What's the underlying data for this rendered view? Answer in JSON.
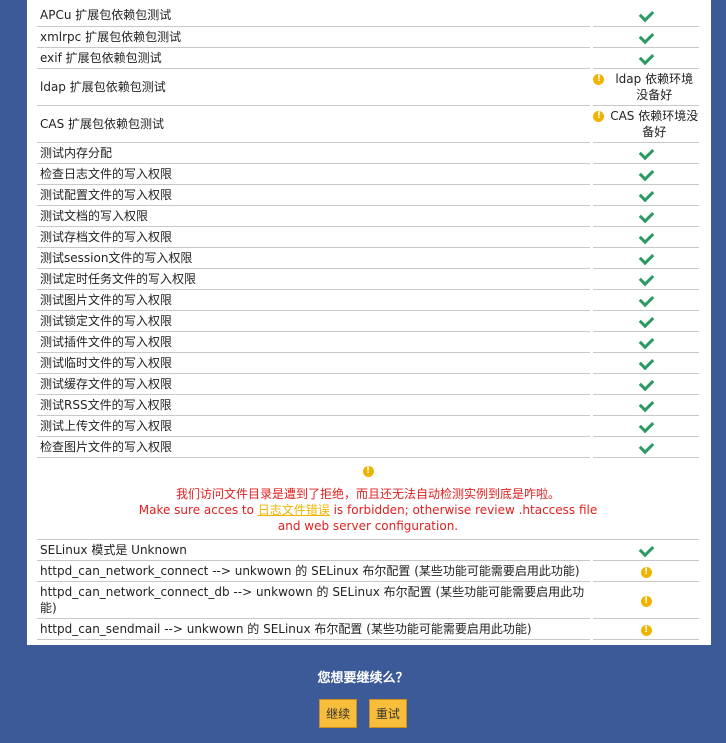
{
  "rows": [
    {
      "label": "APCu 扩展包依赖包测试",
      "status": "ok",
      "h": 21
    },
    {
      "label": "xmlrpc 扩展包依赖包测试",
      "status": "ok",
      "h": 21
    },
    {
      "label": "exif 扩展包依赖包测试",
      "status": "ok",
      "h": 21
    },
    {
      "label": "ldap 扩展包依赖包测试",
      "status": "warn",
      "msg": "ldap 依赖环境没备好",
      "h": 37
    },
    {
      "label": "CAS 扩展包依赖包测试",
      "status": "warn",
      "msg": "CAS 依赖环境没备好",
      "h": 37
    },
    {
      "label": "测试内存分配",
      "status": "ok",
      "h": 21
    },
    {
      "label": "检查日志文件的写入权限",
      "status": "ok",
      "h": 21
    },
    {
      "label": "测试配置文件的写入权限",
      "status": "ok",
      "h": 21
    },
    {
      "label": "测试文档的写入权限",
      "status": "ok",
      "h": 21
    },
    {
      "label": "测试存档文件的写入权限",
      "status": "ok",
      "h": 21
    },
    {
      "label": "测试session文件的写入权限",
      "status": "ok",
      "h": 21
    },
    {
      "label": "测试定时任务文件的写入权限",
      "status": "ok",
      "h": 21
    },
    {
      "label": "测试图片文件的写入权限",
      "status": "ok",
      "h": 21
    },
    {
      "label": "测试锁定文件的写入权限",
      "status": "ok",
      "h": 21
    },
    {
      "label": "测试插件文件的写入权限",
      "status": "ok",
      "h": 21
    },
    {
      "label": "测试临时文件的写入权限",
      "status": "ok",
      "h": 21
    },
    {
      "label": "测试缓存文件的写入权限",
      "status": "ok",
      "h": 21
    },
    {
      "label": "测试RSS文件的写入权限",
      "status": "ok",
      "h": 21
    },
    {
      "label": "测试上传文件的写入权限",
      "status": "ok",
      "h": 21
    },
    {
      "label": "检查图片文件的写入权限",
      "status": "ok",
      "h": 21
    }
  ],
  "access_warning": {
    "line1": "我们访问文件目录是遭到了拒绝，而且还无法自动检测实例到底是咋啦。",
    "line2_pre": "Make sure acces to ",
    "line2_link": "日志文件错误",
    "line2_post": " is forbidden; otherwise review .htaccess file and web server configuration."
  },
  "selinux_rows": [
    {
      "label": "SELinux 模式是 Unknown",
      "status": "ok",
      "h": 21
    },
    {
      "label": "httpd_can_network_connect --> unkwown 的 SELinux 布尔配置 (某些功能可能需要启用此功能)",
      "status": "warn",
      "h": 21
    },
    {
      "label": "httpd_can_network_connect_db --> unkwown 的 SELinux 布尔配置 (某些功能可能需要启用此功能)",
      "status": "warn",
      "h": 37
    },
    {
      "label": "httpd_can_sendmail --> unkwown 的 SELinux 布尔配置 (某些功能可能需要启用此功能)",
      "status": "warn",
      "h": 21
    }
  ],
  "continue_text": "您想要继续么？",
  "buttons": {
    "continue": "继续",
    "retry": "重试"
  },
  "icons": {
    "ok": "check-icon",
    "warn": "warning-icon"
  },
  "colors": {
    "ok": "#2a9a62",
    "warn": "#f0b400",
    "error_text": "#e02020",
    "background": "#3b5a97",
    "button": "#f7bd3b"
  }
}
